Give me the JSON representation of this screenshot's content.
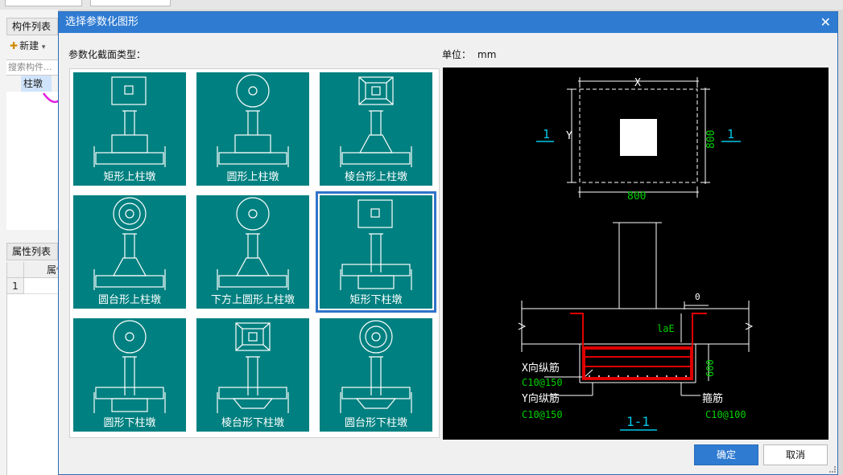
{
  "background": {
    "component_list_title": "构件列表",
    "new_label": "新建",
    "search_placeholder": "搜索构件...",
    "tree_item": "柱墩",
    "property_list_title": "属性列表",
    "property_column_header": "属性",
    "row_number": "1"
  },
  "dialog": {
    "title": "选择参数化图形",
    "section_label": "参数化截面类型：",
    "unit_label": "单位：",
    "unit_value": "mm",
    "ok_label": "确定",
    "cancel_label": "取消"
  },
  "shapes": [
    {
      "label": "矩形上柱墩",
      "top": "rect",
      "body": "rect-up"
    },
    {
      "label": "圆形上柱墩",
      "top": "circle",
      "body": "rect-up"
    },
    {
      "label": "棱台形上柱墩",
      "top": "frustum",
      "body": "trap-up"
    },
    {
      "label": "圆台形上柱墩",
      "top": "double-circle",
      "body": "trap-up"
    },
    {
      "label": "下方上圆形上柱墩",
      "top": "circle",
      "body": "trap-up"
    },
    {
      "label": "矩形下柱墩",
      "top": "rect",
      "body": "rect-down"
    },
    {
      "label": "圆形下柱墩",
      "top": "circle",
      "body": "rect-down"
    },
    {
      "label": "棱台形下柱墩",
      "top": "frustum",
      "body": "trap-down"
    },
    {
      "label": "圆台形下柱墩",
      "top": "double-circle",
      "body": "trap-down"
    }
  ],
  "selected_shape": "矩形下柱墩",
  "preview": {
    "dim_x": "X",
    "dim_y": "Y",
    "dim_800_h": "800",
    "dim_800_v": "800",
    "section_mark": "1",
    "dim_0": "0",
    "dim_lae": "laE",
    "dim_600": "600",
    "x_rebar_label": "X向纵筋",
    "x_rebar_spec": "C10@150",
    "y_rebar_label": "Y向纵筋",
    "y_rebar_spec": "C10@150",
    "stirrup_label": "箍筋",
    "stirrup_spec": "C10@100",
    "section_title": "1-1",
    "colors": {
      "white": "#ffffff",
      "green": "#00d000",
      "cyan": "#00c8e8",
      "red": "#e00000"
    }
  }
}
